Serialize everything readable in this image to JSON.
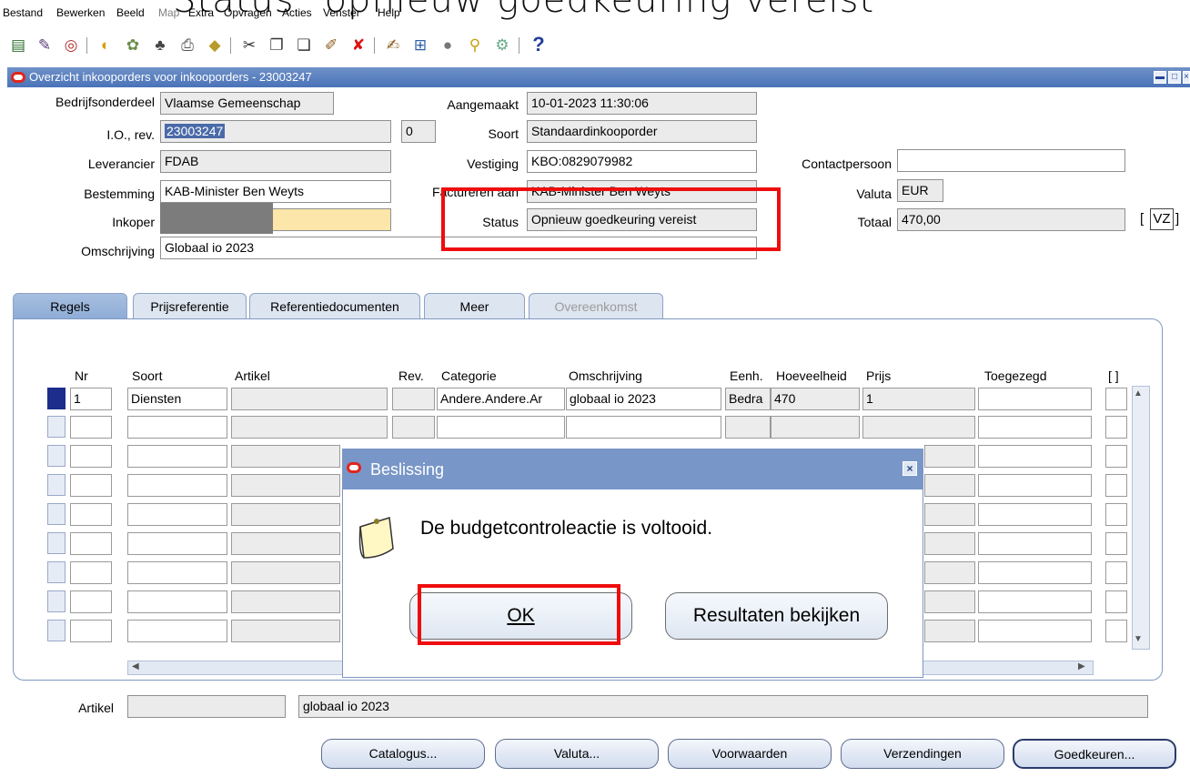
{
  "caption": "Status \"opnieuw goedkeuring vereist\"",
  "menu": [
    {
      "label": "Bestand",
      "disabled": false
    },
    {
      "label": "Bewerken",
      "disabled": false
    },
    {
      "label": "Beeld",
      "disabled": false
    },
    {
      "label": "Map",
      "disabled": true
    },
    {
      "label": "Extra",
      "disabled": false
    },
    {
      "label": "Opvragen",
      "disabled": false
    },
    {
      "label": "Acties",
      "disabled": false
    },
    {
      "label": "Venster",
      "disabled": false
    },
    {
      "label": "Help",
      "disabled": false
    }
  ],
  "toolbar": {
    "icons": [
      "new-icon",
      "open-icon",
      "refresh-icon",
      "save-icon",
      "next-step-icon",
      "switch-responsibility-icon",
      "print-icon",
      "close-form-icon",
      "cut-icon",
      "copy-icon",
      "paste-icon",
      "new-record-icon",
      "delete-record-icon",
      "edit-field-icon",
      "zoom-icon",
      "translations-icon",
      "attachments-icon",
      "folder-tools-icon",
      "help-icon"
    ],
    "help_glyph": "?"
  },
  "window": {
    "title": "Overzicht inkooporders voor inkooporders - 23003247"
  },
  "form": {
    "bedrijfsonderdeel_label": "Bedrijfsonderdeel",
    "bedrijfsonderdeel": "Vlaamse Gemeenschap",
    "aangemaakt_label": "Aangemaakt",
    "aangemaakt": "10-01-2023 11:30:06",
    "io_label": "I.O., rev.",
    "io": "23003247",
    "rev": "0",
    "soort_label": "Soort",
    "soort": "Standaardinkooporder",
    "leverancier_label": "Leverancier",
    "leverancier": "FDAB",
    "vestiging_label": "Vestiging",
    "vestiging": "KBO:0829079982",
    "contactpersoon_label": "Contactpersoon",
    "contactpersoon": "",
    "bestemming_label": "Bestemming",
    "bestemming": "KAB-Minister Ben Weyts",
    "factureren_label": "Factureren aan",
    "factureren": "KAB-Minister Ben Weyts",
    "valuta_label": "Valuta",
    "valuta": "EUR",
    "inkoper_label": "Inkoper",
    "status_label": "Status",
    "status": "Opnieuw goedkeuring vereist",
    "totaal_label": "Totaal",
    "totaal": "470,00",
    "vz_left": "[",
    "vz": "VZ",
    "vz_right": "]",
    "omschrijving_label": "Omschrijving",
    "omschrijving": "Globaal io 2023"
  },
  "tabs": [
    {
      "label": "Regels",
      "active": true,
      "disabled": false
    },
    {
      "label": "Prijsreferentie",
      "active": false,
      "disabled": false
    },
    {
      "label": "Referentiedocumenten",
      "active": false,
      "disabled": false
    },
    {
      "label": "Meer",
      "active": false,
      "disabled": false
    },
    {
      "label": "Overeenkomst",
      "active": false,
      "disabled": true
    }
  ],
  "lines": {
    "headers": {
      "nr": "Nr",
      "soort": "Soort",
      "artikel": "Artikel",
      "rev": "Rev.",
      "categorie": "Categorie",
      "omschrijving": "Omschrijving",
      "eenh": "Eenh.",
      "hoeveelheid": "Hoeveelheid",
      "prijs": "Prijs",
      "toegezegd": "Toegezegd",
      "flex": "[ ]"
    },
    "row1": {
      "nr": "1",
      "soort": "Diensten",
      "artikel": "",
      "rev": "",
      "categorie": "Andere.Andere.Ar",
      "omschrijving": "globaal io 2023",
      "eenh": "Bedra",
      "hoeveelheid": "470",
      "prijs": "1",
      "toegezegd": ""
    }
  },
  "bottom": {
    "artikel_label": "Artikel",
    "artikel": "",
    "omschrijving": "globaal io 2023"
  },
  "buttons": {
    "catalogus": "Catalogus...",
    "valuta": "Valuta...",
    "voorwaarden": "Voorwaarden",
    "verzendingen": "Verzendingen",
    "goedkeuren": "Goedkeuren..."
  },
  "dialog": {
    "title": "Beslissing",
    "message": "De budgetcontroleactie is voltooid.",
    "ok": "OK",
    "results": "Resultaten bekijken"
  },
  "colors": {
    "highlight": "#ee0d0d",
    "title_bar": "#4a73b8",
    "oracle_red": "#e0261c"
  }
}
